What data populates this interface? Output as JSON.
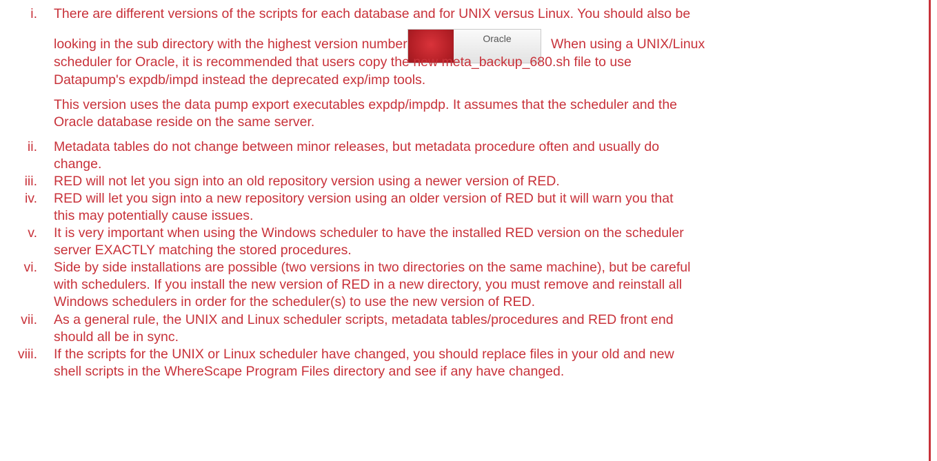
{
  "button": {
    "label": "Oracle"
  },
  "items": [
    {
      "numeral": "i.",
      "lines": [
        "There are different versions of the scripts for each database and for UNIX versus Linux. You should also be",
        "looking in the sub directory with the highest version number.",
        "When using a UNIX/Linux",
        "scheduler for Oracle, it is recommended that users copy the new meta_backup_680.sh file to use",
        "Datapump's expdb/impd instead the deprecated exp/imp tools."
      ],
      "extra": [
        "This version uses the data pump export executables expdp/impdp. It assumes that the scheduler and the",
        "Oracle database reside on the same server."
      ]
    },
    {
      "numeral": "ii.",
      "lines": [
        "Metadata tables do not change between minor releases, but metadata procedure often and usually do",
        "change."
      ]
    },
    {
      "numeral": "iii.",
      "lines": [
        "RED will not let you sign into an old repository version using a newer version of RED."
      ]
    },
    {
      "numeral": "iv.",
      "lines": [
        "RED will let you sign into a new repository version using an older version of RED but it will warn you that",
        "this may potentially cause issues."
      ]
    },
    {
      "numeral": "v.",
      "lines": [
        "It is very important when using the Windows scheduler to have the installed RED version on the scheduler",
        "server EXACTLY matching the stored procedures."
      ]
    },
    {
      "numeral": "vi.",
      "lines": [
        "Side by side installations are possible (two versions in two directories on the same machine), but be careful",
        "with schedulers. If you install the new version of RED in a new directory, you must remove and reinstall all",
        "Windows schedulers in order for the scheduler(s) to use the new version of RED."
      ]
    },
    {
      "numeral": "vii.",
      "lines": [
        "As a general rule, the UNIX and Linux scheduler scripts, metadata tables/procedures and RED front end",
        "should all be in sync."
      ]
    },
    {
      "numeral": "viii.",
      "lines": [
        "If the scripts for the UNIX or Linux scheduler have changed, you should replace files in your old and new",
        "shell scripts in the WhereScape Program Files directory and see if any have changed."
      ]
    }
  ]
}
